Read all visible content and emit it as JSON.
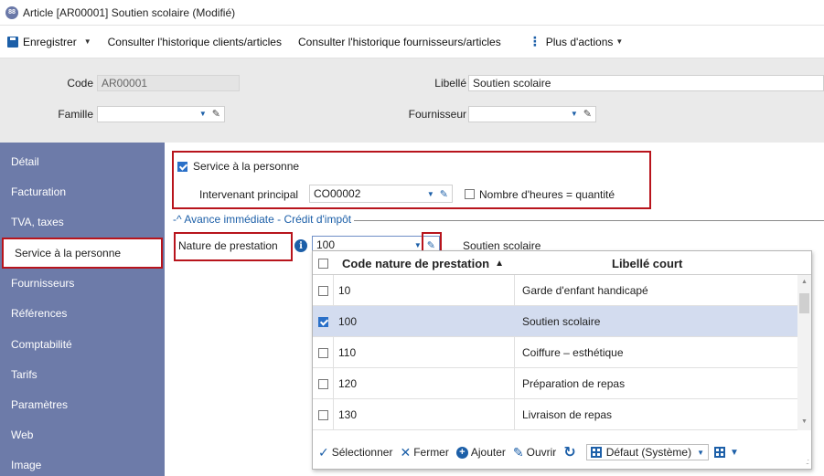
{
  "window": {
    "badge": "88",
    "title": "Article [AR00001] Soutien scolaire (Modifié)"
  },
  "toolbar": {
    "save_label": "Enregistrer",
    "history_clients_label": "Consulter l'historique clients/articles",
    "history_suppliers_label": "Consulter l'historique fournisseurs/articles",
    "more_actions_label": "Plus d'actions"
  },
  "header": {
    "code_label": "Code",
    "code_value": "AR00001",
    "libelle_label": "Libellé",
    "libelle_value": "Soutien scolaire",
    "famille_label": "Famille",
    "famille_value": "",
    "fournisseur_label": "Fournisseur",
    "fournisseur_value": ""
  },
  "sidebar": {
    "items": [
      {
        "label": "Détail"
      },
      {
        "label": "Facturation"
      },
      {
        "label": "TVA, taxes"
      },
      {
        "label": "Service à la personne"
      },
      {
        "label": "Fournisseurs"
      },
      {
        "label": "Références"
      },
      {
        "label": "Comptabilité"
      },
      {
        "label": "Tarifs"
      },
      {
        "label": "Paramètres"
      },
      {
        "label": "Web"
      },
      {
        "label": "Image"
      }
    ],
    "active_index": 3
  },
  "service": {
    "checkbox_label": "Service à la personne",
    "checked": true,
    "intervenant_label": "Intervenant principal",
    "intervenant_value": "CO00002",
    "hours_label": "Nombre d'heures = quantité",
    "hours_checked": false,
    "group_title": "Avance immédiate - Crédit d'impôt",
    "nature_label": "Nature de prestation",
    "nature_value": "100",
    "nature_desc": "Soutien scolaire"
  },
  "grid": {
    "headers": {
      "code": "Code nature de prestation",
      "libelle": "Libellé court"
    },
    "rows": [
      {
        "code": "10",
        "libelle": "Garde d'enfant handicapé",
        "selected": false
      },
      {
        "code": "100",
        "libelle": "Soutien scolaire",
        "selected": true
      },
      {
        "code": "110",
        "libelle": "Coiffure – esthétique",
        "selected": false
      },
      {
        "code": "120",
        "libelle": "Préparation de repas",
        "selected": false
      },
      {
        "code": "130",
        "libelle": "Livraison de repas",
        "selected": false
      }
    ]
  },
  "footer": {
    "select_label": "Sélectionner",
    "close_label": "Fermer",
    "add_label": "Ajouter",
    "open_label": "Ouvrir",
    "layout_value": "Défaut (Système)"
  },
  "colors": {
    "accent": "#1c5fa8",
    "sidebar": "#6d7ba9",
    "highlight_border": "#b8141c",
    "selected_row": "#d3dcef"
  }
}
